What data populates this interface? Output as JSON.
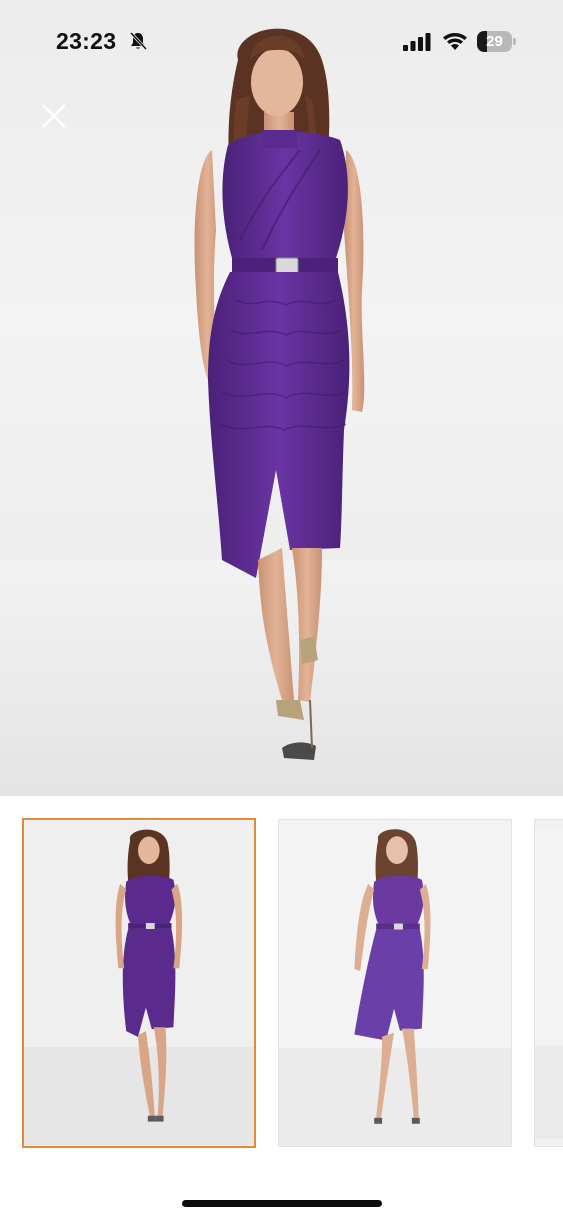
{
  "status_bar": {
    "time": "23:23",
    "battery_level": "29",
    "battery_fraction": 0.29,
    "icons": [
      "bell-muted-icon",
      "cellular-signal-icon",
      "wifi-icon",
      "battery-icon"
    ]
  },
  "close_button": {
    "icon": "close-icon"
  },
  "gallery": {
    "main_image": "model-purple-dress-front",
    "selected_index": 0,
    "thumbnails": [
      {
        "image": "model-purple-dress-front",
        "selected": true
      },
      {
        "image": "model-purple-dress-angle",
        "selected": false
      },
      {
        "image": "model-purple-dress-partial",
        "selected": false
      }
    ]
  },
  "colors": {
    "dress": "#5a2a8c",
    "selected_border": "#e08a3c",
    "background": "#f2f2f2"
  }
}
